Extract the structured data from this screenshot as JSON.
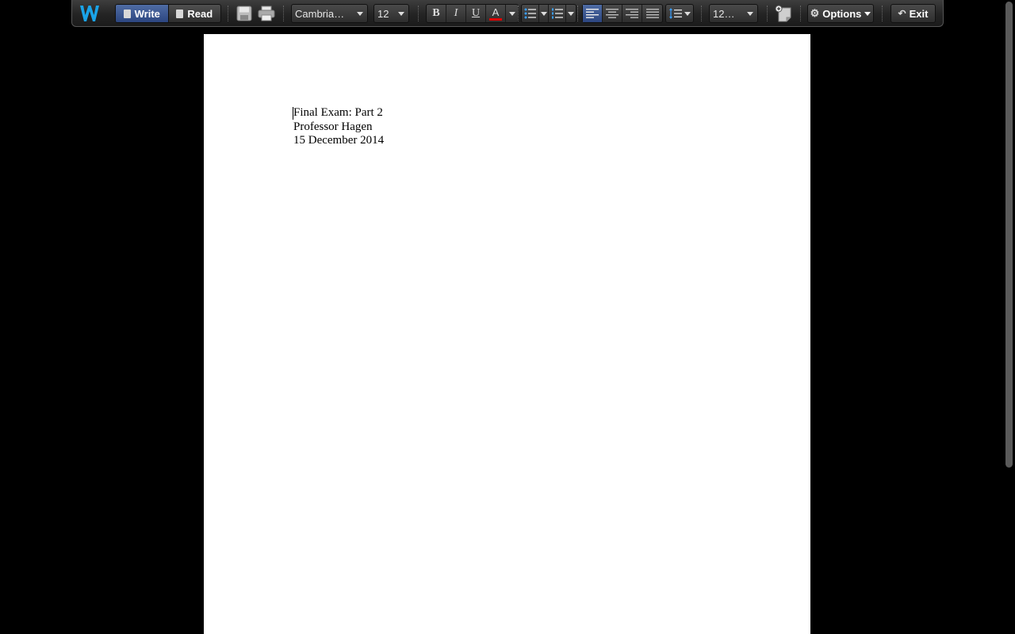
{
  "toolbar": {
    "logo_icon": "w-logo-icon",
    "mode": {
      "write_label": "Write",
      "read_label": "Read",
      "active": "write"
    },
    "save_icon": "floppy-disk-icon",
    "print_icon": "printer-icon",
    "font_family": "Cambria…",
    "font_size": "12",
    "bold_label": "B",
    "italic_label": "I",
    "underline_label": "U",
    "font_color_label": "A",
    "font_color": "#e00000",
    "bullet_list_icon": "bullet-list-icon",
    "numbered_list_icon": "numbered-list-icon",
    "alignment": {
      "active": "left",
      "options": [
        "left",
        "center",
        "right",
        "justify"
      ]
    },
    "line_spacing_icon": "line-spacing-icon",
    "zoom_value": "12…",
    "insert_icon": "insert-note-icon",
    "options_label": "Options",
    "exit_label": "Exit"
  },
  "document": {
    "lines": [
      "Final Exam: Part 2",
      "Professor Hagen",
      "15 December 2014"
    ]
  },
  "colors": {
    "accent": "#2c4680",
    "logo": "#1aa3e8"
  }
}
